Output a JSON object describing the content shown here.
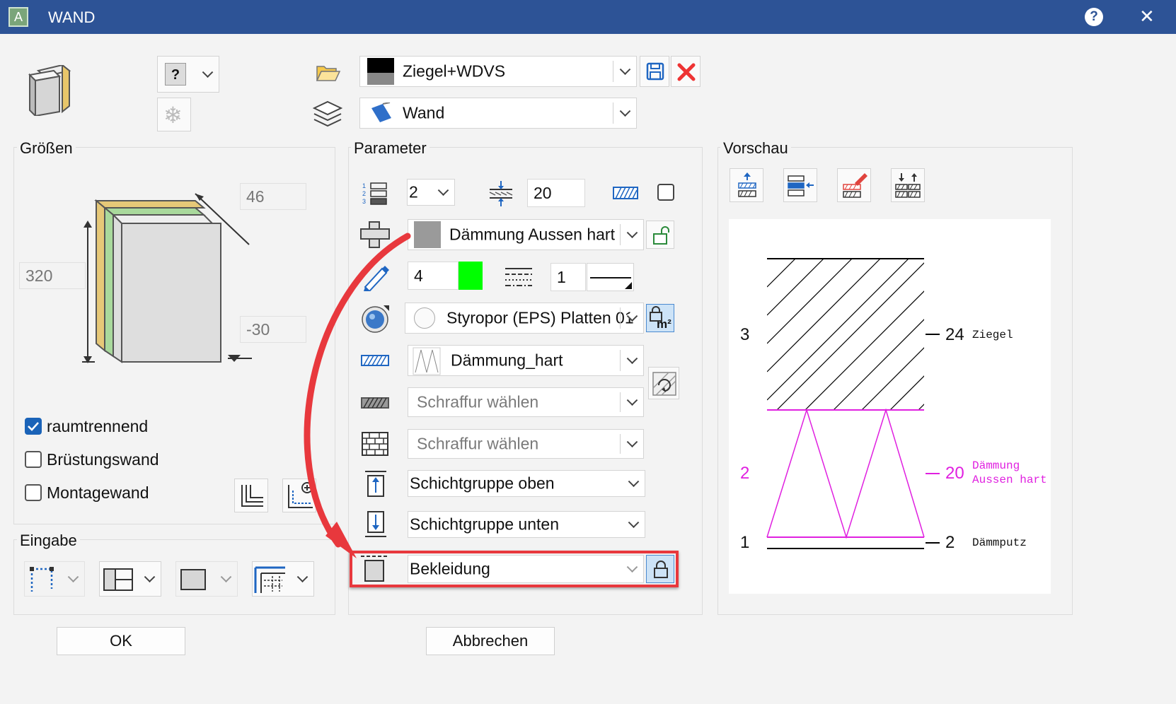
{
  "window": {
    "title": "WAND",
    "help": "?",
    "close": "✕"
  },
  "top": {
    "type_dropdown_value": "?",
    "style_combo": {
      "value": "Ziegel+WDVS"
    },
    "layer_combo": {
      "value": "Wand"
    }
  },
  "sizes": {
    "label": "Größen",
    "depth": "46",
    "height": "320",
    "offset": "-30",
    "checkboxes": [
      {
        "label": "raumtrennend",
        "checked": true
      },
      {
        "label": "Brüstungswand",
        "checked": false
      },
      {
        "label": "Montagewand",
        "checked": false
      }
    ]
  },
  "input_group": {
    "label": "Eingabe"
  },
  "parameter": {
    "label": "Parameter",
    "layer_count": "2",
    "layer_thickness": "20",
    "material": "Dämmung Aussen hart",
    "pen_thickness": "4",
    "pen_color": "#00ff00",
    "line_type": "1",
    "surface": "Styropor (EPS) Platten 01",
    "hatch": "Dämmung_hart",
    "hatch_placeholder_1": "Schraffur wählen",
    "hatch_placeholder_2": "Schraffur wählen",
    "group_top": "Schichtgruppe oben",
    "group_bottom": "Schichtgruppe unten",
    "cladding": "Bekleidung",
    "surface_lock_unit": "m²"
  },
  "preview": {
    "label": "Vorschau",
    "layers": [
      {
        "index": "3",
        "thickness": "24",
        "name": "Ziegel",
        "color": "#000000"
      },
      {
        "index": "2",
        "thickness": "20",
        "name_line1": "Dämmung",
        "name_line2": "Aussen hart",
        "color": "#e020e0"
      },
      {
        "index": "1",
        "thickness": "2",
        "name": "Dämmputz",
        "color": "#000000"
      }
    ]
  },
  "footer": {
    "ok": "OK",
    "cancel": "Abbrechen"
  },
  "colors": {
    "accent_title": "#2d5396",
    "highlight": "#e8383d",
    "magenta": "#e020e0"
  }
}
